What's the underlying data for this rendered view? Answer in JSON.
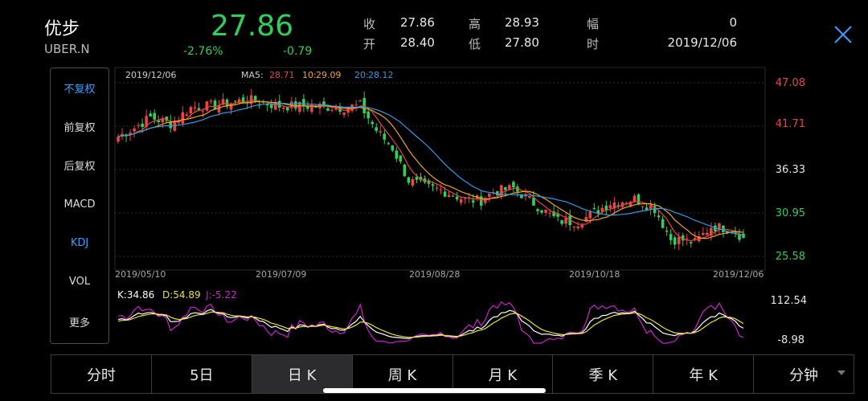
{
  "header": {
    "name": "优步",
    "ticker": "UBER.N",
    "price": "27.86",
    "change_pct": "-2.76%",
    "change": "-0.79",
    "close_label": "收",
    "close_value": "27.86",
    "open_label": "开",
    "open_value": "28.40",
    "high_label": "高",
    "high_value": "28.93",
    "low_label": "低",
    "low_value": "27.80",
    "amp_label": "幅",
    "amp_value": "0",
    "time_label": "时",
    "time_value": "2019/12/06"
  },
  "colors": {
    "up": "#e84545",
    "down": "#2fd05a",
    "ma5": "#e84545",
    "ma10": "#f0a422",
    "ma20": "#2f9be0",
    "k": "#ffffff",
    "d": "#e8e035",
    "j": "#d020d0",
    "accent": "#3aa0ff"
  },
  "sidebar": {
    "items": [
      {
        "label": "不复权",
        "active": true
      },
      {
        "label": "前复权"
      },
      {
        "label": "后复权"
      },
      {
        "label": "MACD"
      },
      {
        "label": "KDJ",
        "active": true
      },
      {
        "label": "VOL"
      },
      {
        "label": "更多"
      }
    ]
  },
  "main_chart": {
    "date_label": "2019/12/06",
    "ma5_label": "MA5:",
    "ma5_value": "28.71",
    "ma10_label": "10:",
    "ma10_value": "29.09",
    "ma20_label": "20:",
    "ma20_value": "28.12",
    "y_ticks": [
      "47.08",
      "41.71",
      "36.33",
      "30.95",
      "25.58"
    ]
  },
  "x_ticks": [
    "2019/05/10",
    "2019/07/09",
    "2019/08/28",
    "2019/10/18",
    "2019/12/06"
  ],
  "kdj": {
    "k_label": "K:34.86",
    "d_label": "D:54.89",
    "j_label": "J:-5.22",
    "y_max": "112.54",
    "y_min": "-8.98"
  },
  "tabs": [
    {
      "label": "分时"
    },
    {
      "label": "5日"
    },
    {
      "label": "日 K",
      "active": true
    },
    {
      "label": "周 K"
    },
    {
      "label": "月 K"
    },
    {
      "label": "季 K"
    },
    {
      "label": "年 K"
    },
    {
      "label": "分钟",
      "dropdown": true
    }
  ],
  "chart_data": [
    {
      "type": "candlestick",
      "title": "",
      "x_range": [
        "2019/05/10",
        "2019/12/06"
      ],
      "ylim": [
        25.58,
        47.08
      ],
      "y_ticks": [
        47.08,
        41.71,
        36.33,
        30.95,
        25.58
      ],
      "close_path": [
        [
          0,
          40.4
        ],
        [
          4,
          41.5
        ],
        [
          8,
          42.8
        ],
        [
          13,
          42.0
        ],
        [
          18,
          44.0
        ],
        [
          24,
          44.3
        ],
        [
          32,
          45.0
        ],
        [
          40,
          44.2
        ],
        [
          48,
          44.2
        ],
        [
          56,
          44.0
        ],
        [
          60,
          44.3
        ],
        [
          64,
          41.2
        ],
        [
          68,
          39.0
        ],
        [
          72,
          35.0
        ],
        [
          76,
          34.2
        ],
        [
          80,
          33.8
        ],
        [
          86,
          32.6
        ],
        [
          90,
          32.5
        ],
        [
          93,
          33.6
        ],
        [
          98,
          34.0
        ],
        [
          104,
          31.8
        ],
        [
          109,
          30.0
        ],
        [
          114,
          29.8
        ],
        [
          118,
          31.0
        ],
        [
          122,
          32.2
        ],
        [
          128,
          32.7
        ],
        [
          133,
          31.5
        ],
        [
          137,
          27.7
        ],
        [
          140,
          27.6
        ],
        [
          143,
          27.3
        ],
        [
          147,
          29.3
        ],
        [
          152,
          29.0
        ],
        [
          155,
          27.86
        ]
      ],
      "ma5_last": 28.71,
      "ma10_last": 29.09,
      "ma20_last": 28.12
    },
    {
      "type": "line",
      "title": "KDJ",
      "ylim": [
        -8.98,
        112.54
      ],
      "series": [
        {
          "name": "K",
          "last": 34.86
        },
        {
          "name": "D",
          "last": 54.89
        },
        {
          "name": "J",
          "last": -5.22
        }
      ]
    }
  ]
}
